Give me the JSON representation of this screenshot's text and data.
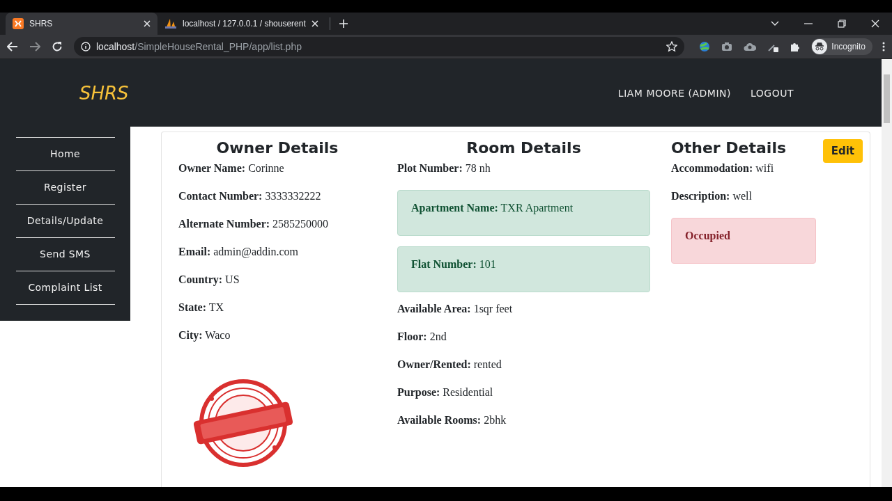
{
  "browser": {
    "tabs": [
      {
        "title": "SHRS",
        "selected": true
      },
      {
        "title": "localhost / 127.0.0.1 / shouserent",
        "selected": false
      }
    ],
    "address": {
      "host": "localhost",
      "path": "/SimpleHouseRental_PHP/app/list.php"
    },
    "profile": "Incognito"
  },
  "navbar": {
    "brand": "SHRS",
    "links": [
      "LIAM MOORE (ADMIN)",
      "LOGOUT"
    ]
  },
  "sidebar": {
    "items": [
      "Home",
      "Register",
      "Details/Update",
      "Send SMS",
      "Complaint List"
    ]
  },
  "edit_button": "Edit",
  "sections": [
    {
      "title": "Owner Details",
      "fields": [
        {
          "kind": "plain",
          "label": "Owner Name:",
          "value": "Corinne"
        },
        {
          "kind": "plain",
          "label": "Contact Number:",
          "value": "3333332222"
        },
        {
          "kind": "plain",
          "label": "Alternate Number:",
          "value": "2585250000"
        },
        {
          "kind": "plain",
          "label": "Email:",
          "value": "admin@addin.com"
        },
        {
          "kind": "plain",
          "label": "Country:",
          "value": "US"
        },
        {
          "kind": "plain",
          "label": "State:",
          "value": "TX"
        },
        {
          "kind": "plain",
          "label": "City:",
          "value": "Waco"
        },
        {
          "kind": "picture"
        }
      ]
    },
    {
      "title": "Room Details",
      "fields": [
        {
          "kind": "plain",
          "label": "Plot Number:",
          "value": "78 nh"
        },
        {
          "kind": "success",
          "label": "Apartment Name:",
          "value": "TXR Apartment"
        },
        {
          "kind": "success",
          "label": "Flat Number:",
          "value": "101"
        },
        {
          "kind": "plain",
          "label": "Available Area:",
          "value": "1sqr feet"
        },
        {
          "kind": "plain",
          "label": "Floor:",
          "value": "2nd"
        },
        {
          "kind": "plain",
          "label": "Owner/Rented:",
          "value": "rented"
        },
        {
          "kind": "plain",
          "label": "Purpose:",
          "value": "Residential"
        },
        {
          "kind": "plain",
          "label": "Available Rooms:",
          "value": "2bhk"
        }
      ]
    },
    {
      "title": "Other Details",
      "fields": [
        {
          "kind": "plain",
          "label": "Accommodation:",
          "value": "wifi"
        },
        {
          "kind": "plain",
          "label": "Description:",
          "value": "well"
        },
        {
          "kind": "danger",
          "label": "Occupied"
        }
      ]
    }
  ]
}
